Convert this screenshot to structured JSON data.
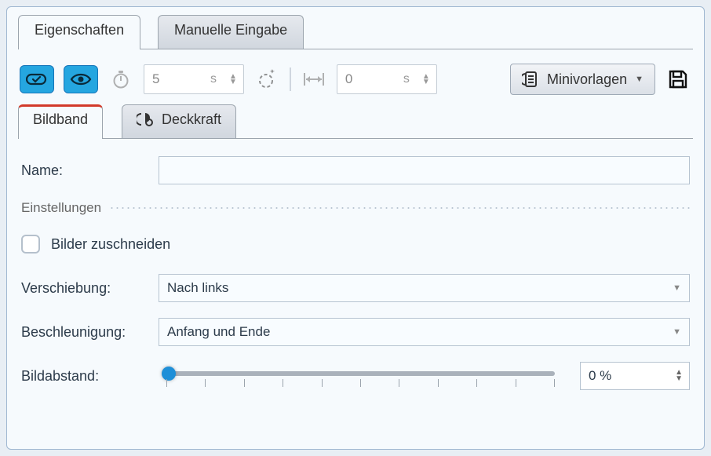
{
  "topTabs": {
    "properties": "Eigenschaften",
    "manual": "Manuelle Eingabe"
  },
  "toolbar": {
    "duration_value": "5",
    "duration_unit": "s",
    "offset_value": "0",
    "offset_unit": "s",
    "mini_label": "Minivorlagen"
  },
  "subTabs": {
    "bildband": "Bildband",
    "deckkraft": "Deckkraft"
  },
  "form": {
    "name_label": "Name:",
    "name_value": "",
    "section": "Einstellungen",
    "crop_label": "Bilder zuschneiden",
    "shift_label": "Verschiebung:",
    "shift_value": "Nach links",
    "accel_label": "Beschleunigung:",
    "accel_value": "Anfang und Ende",
    "spacing_label": "Bildabstand:",
    "spacing_value": "0 %"
  }
}
